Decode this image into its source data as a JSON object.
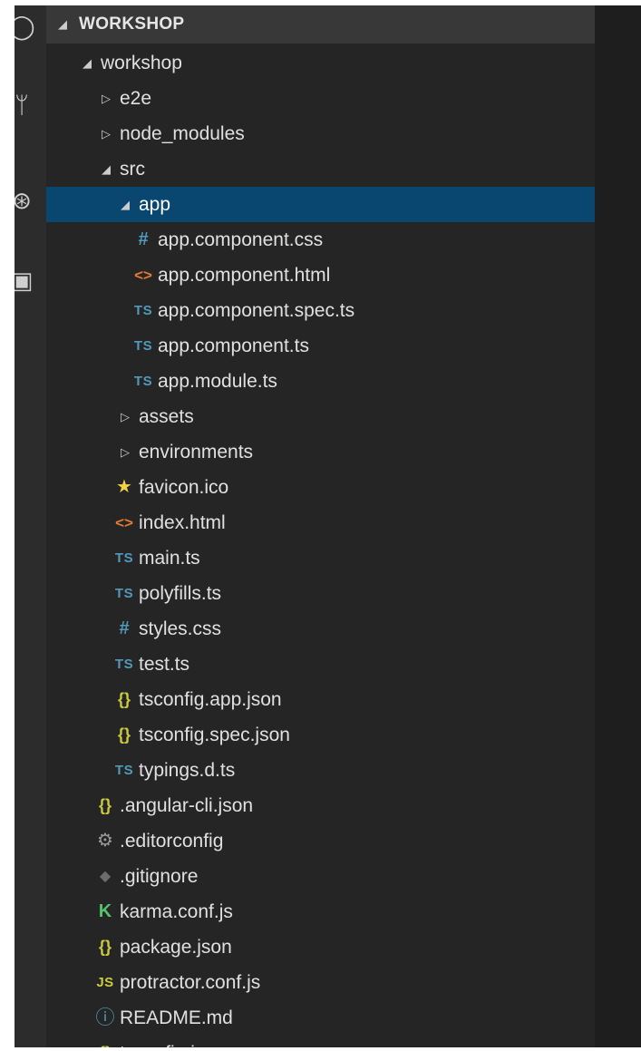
{
  "explorer": {
    "section_title": "WORKSHOP",
    "items": [
      {
        "label": "workshop",
        "type": "folder",
        "expanded": true,
        "depth": 1
      },
      {
        "label": "e2e",
        "type": "folder",
        "expanded": false,
        "depth": 2
      },
      {
        "label": "node_modules",
        "type": "folder",
        "expanded": false,
        "depth": 2
      },
      {
        "label": "src",
        "type": "folder",
        "expanded": true,
        "depth": 2
      },
      {
        "label": "app",
        "type": "folder",
        "expanded": true,
        "depth": 3,
        "selected": true
      },
      {
        "label": "app.component.css",
        "type": "file",
        "icon": "css-hash-icon",
        "icon_text": "#",
        "depth": 4
      },
      {
        "label": "app.component.html",
        "type": "file",
        "icon": "html-brackets-icon",
        "icon_text": "<>",
        "depth": 4
      },
      {
        "label": "app.component.spec.ts",
        "type": "file",
        "icon": "typescript-icon",
        "icon_text": "TS",
        "depth": 4
      },
      {
        "label": "app.component.ts",
        "type": "file",
        "icon": "typescript-icon",
        "icon_text": "TS",
        "depth": 4
      },
      {
        "label": "app.module.ts",
        "type": "file",
        "icon": "typescript-icon",
        "icon_text": "TS",
        "depth": 4
      },
      {
        "label": "assets",
        "type": "folder",
        "expanded": false,
        "depth": 3
      },
      {
        "label": "environments",
        "type": "folder",
        "expanded": false,
        "depth": 3
      },
      {
        "label": "favicon.ico",
        "type": "file",
        "icon": "star-icon",
        "icon_text": "★",
        "depth": 3
      },
      {
        "label": "index.html",
        "type": "file",
        "icon": "html-brackets-icon",
        "icon_text": "<>",
        "depth": 3
      },
      {
        "label": "main.ts",
        "type": "file",
        "icon": "typescript-icon",
        "icon_text": "TS",
        "depth": 3
      },
      {
        "label": "polyfills.ts",
        "type": "file",
        "icon": "typescript-icon",
        "icon_text": "TS",
        "depth": 3
      },
      {
        "label": "styles.css",
        "type": "file",
        "icon": "css-hash-icon",
        "icon_text": "#",
        "depth": 3
      },
      {
        "label": "test.ts",
        "type": "file",
        "icon": "typescript-icon",
        "icon_text": "TS",
        "depth": 3
      },
      {
        "label": "tsconfig.app.json",
        "type": "file",
        "icon": "json-braces-icon",
        "icon_text": "{}",
        "depth": 3
      },
      {
        "label": "tsconfig.spec.json",
        "type": "file",
        "icon": "json-braces-icon",
        "icon_text": "{}",
        "depth": 3
      },
      {
        "label": "typings.d.ts",
        "type": "file",
        "icon": "typescript-icon",
        "icon_text": "TS",
        "depth": 3
      },
      {
        "label": ".angular-cli.json",
        "type": "file",
        "icon": "json-braces-icon",
        "icon_text": "{}",
        "depth": 2
      },
      {
        "label": ".editorconfig",
        "type": "file",
        "icon": "gear-icon",
        "icon_text": "⚙",
        "depth": 2
      },
      {
        "label": ".gitignore",
        "type": "file",
        "icon": "git-icon",
        "icon_text": "◆",
        "depth": 2
      },
      {
        "label": "karma.conf.js",
        "type": "file",
        "icon": "karma-icon",
        "icon_text": "K",
        "depth": 2
      },
      {
        "label": "package.json",
        "type": "file",
        "icon": "json-braces-icon",
        "icon_text": "{}",
        "depth": 2
      },
      {
        "label": "protractor.conf.js",
        "type": "file",
        "icon": "javascript-icon",
        "icon_text": "JS",
        "depth": 2
      },
      {
        "label": "README.md",
        "type": "file",
        "icon": "info-icon",
        "icon_text": "ⓘ",
        "depth": 2
      },
      {
        "label": "tsconfig.json",
        "type": "file",
        "icon": "json-braces-icon",
        "icon_text": "{}",
        "depth": 2
      }
    ]
  },
  "activity_bar": {
    "icons": [
      {
        "name": "search-icon",
        "glyph": "◯"
      },
      {
        "name": "source-control-icon",
        "glyph": "ᛘ"
      },
      {
        "name": "debug-icon",
        "glyph": "⊛"
      },
      {
        "name": "extensions-icon",
        "glyph": "▣"
      }
    ]
  },
  "colors": {
    "sidebar_bg": "#252526",
    "section_header_bg": "#383838",
    "selection_bg": "#094771",
    "ts_icon": "#519aba",
    "html_icon": "#e37933",
    "json_icon": "#cbcb41"
  }
}
